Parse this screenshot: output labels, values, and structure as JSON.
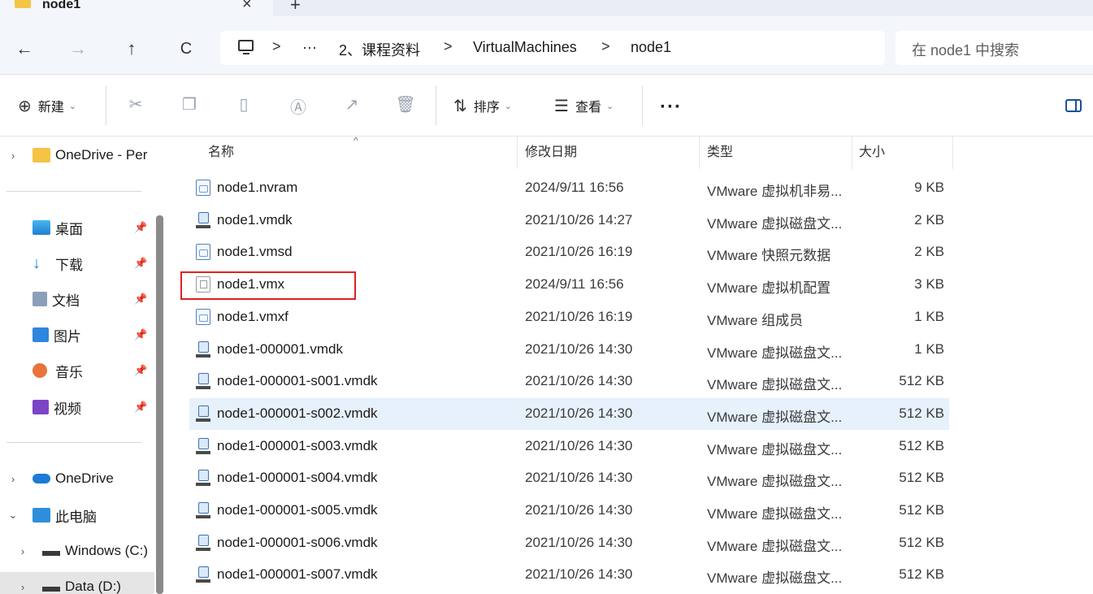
{
  "tab": {
    "title": "node1",
    "close": "×",
    "new": "+"
  },
  "nav": {
    "back": "←",
    "forward": "→",
    "up": "↑",
    "refresh": "C"
  },
  "breadcrumb": {
    "overflow": "···",
    "items": [
      "2、课程资料",
      "VirtualMachines",
      "node1"
    ],
    "sep": ">"
  },
  "search": {
    "placeholder": "在 node1 中搜索"
  },
  "toolbar": {
    "new_label": "新建",
    "sort_label": "排序",
    "view_label": "查看",
    "more": "···",
    "icons": [
      "cut-icon",
      "copy-icon",
      "paste-icon",
      "rename-icon",
      "share-icon",
      "delete-icon"
    ]
  },
  "sidebar": {
    "top": {
      "label": "OneDrive - Per"
    },
    "quick": [
      {
        "label": "桌面"
      },
      {
        "label": "下载"
      },
      {
        "label": "文档"
      },
      {
        "label": "图片"
      },
      {
        "label": "音乐"
      },
      {
        "label": "视频"
      }
    ],
    "onedrive": {
      "label": "OneDrive"
    },
    "thispc": {
      "label": "此电脑"
    },
    "drives": [
      {
        "label": "Windows (C:)"
      },
      {
        "label": "Data (D:)"
      }
    ]
  },
  "columns": {
    "name": "名称",
    "date": "修改日期",
    "type": "类型",
    "size": "大小"
  },
  "files": [
    {
      "name": "node1.nvram",
      "date": "2024/9/11 16:56",
      "type": "VMware 虚拟机非易...",
      "size": "9 KB",
      "icon": "doc"
    },
    {
      "name": "node1.vmdk",
      "date": "2021/10/26 14:27",
      "type": "VMware 虚拟磁盘文...",
      "size": "2 KB",
      "icon": "disk"
    },
    {
      "name": "node1.vmsd",
      "date": "2021/10/26 16:19",
      "type": "VMware 快照元数据",
      "size": "2 KB",
      "icon": "doc"
    },
    {
      "name": "node1.vmx",
      "date": "2024/9/11 16:56",
      "type": "VMware 虚拟机配置",
      "size": "3 KB",
      "icon": "vmx"
    },
    {
      "name": "node1.vmxf",
      "date": "2021/10/26 16:19",
      "type": "VMware 组成员",
      "size": "1 KB",
      "icon": "doc"
    },
    {
      "name": "node1-000001.vmdk",
      "date": "2021/10/26 14:30",
      "type": "VMware 虚拟磁盘文...",
      "size": "1 KB",
      "icon": "disk"
    },
    {
      "name": "node1-000001-s001.vmdk",
      "date": "2021/10/26 14:30",
      "type": "VMware 虚拟磁盘文...",
      "size": "512 KB",
      "icon": "disk"
    },
    {
      "name": "node1-000001-s002.vmdk",
      "date": "2021/10/26 14:30",
      "type": "VMware 虚拟磁盘文...",
      "size": "512 KB",
      "icon": "disk"
    },
    {
      "name": "node1-000001-s003.vmdk",
      "date": "2021/10/26 14:30",
      "type": "VMware 虚拟磁盘文...",
      "size": "512 KB",
      "icon": "disk"
    },
    {
      "name": "node1-000001-s004.vmdk",
      "date": "2021/10/26 14:30",
      "type": "VMware 虚拟磁盘文...",
      "size": "512 KB",
      "icon": "disk"
    },
    {
      "name": "node1-000001-s005.vmdk",
      "date": "2021/10/26 14:30",
      "type": "VMware 虚拟磁盘文...",
      "size": "512 KB",
      "icon": "disk"
    },
    {
      "name": "node1-000001-s006.vmdk",
      "date": "2021/10/26 14:30",
      "type": "VMware 虚拟磁盘文...",
      "size": "512 KB",
      "icon": "disk"
    },
    {
      "name": "node1-000001-s007.vmdk",
      "date": "2021/10/26 14:30",
      "type": "VMware 虚拟磁盘文...",
      "size": "512 KB",
      "icon": "disk"
    }
  ],
  "selected_row": "node1-000001-s002.vmdk",
  "highlighted_file": "node1.vmx",
  "colors": {
    "accent": "#1b4f9c",
    "selection": "#e6f1fb",
    "highlight_border": "#e02020"
  }
}
